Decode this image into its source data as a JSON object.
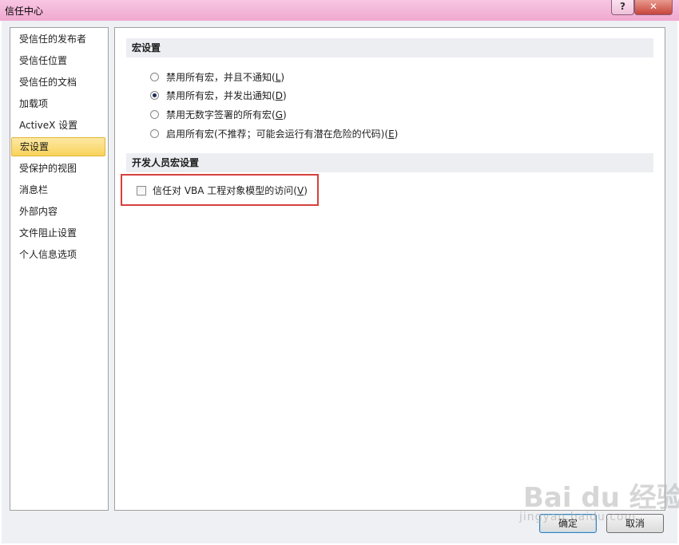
{
  "window": {
    "title": "信任中心"
  },
  "title_buttons": {
    "help": "?",
    "close": "✕"
  },
  "nav": {
    "items": [
      {
        "label": "受信任的发布者"
      },
      {
        "label": "受信任位置"
      },
      {
        "label": "受信任的文档"
      },
      {
        "label": "加载项"
      },
      {
        "label": "ActiveX 设置"
      },
      {
        "label": "宏设置"
      },
      {
        "label": "受保护的视图"
      },
      {
        "label": "消息栏"
      },
      {
        "label": "外部内容"
      },
      {
        "label": "文件阻止设置"
      },
      {
        "label": "个人信息选项"
      }
    ],
    "selected": "宏设置"
  },
  "macro_settings": {
    "header": "宏设置",
    "options": [
      {
        "text": "禁用所有宏，并且不通知(",
        "key": "L",
        "end": ")"
      },
      {
        "text": "禁用所有宏，并发出通知(",
        "key": "D",
        "end": ")"
      },
      {
        "text": "禁用无数字签署的所有宏(",
        "key": "G",
        "end": ")"
      },
      {
        "text": "启用所有宏(不推荐；可能会运行有潜在危险的代码)(",
        "key": "E",
        "end": ")"
      }
    ],
    "selected_index": 1
  },
  "developer": {
    "header": "开发人员宏设置",
    "checkbox_text": "信任对 VBA 工程对象模型的访问(",
    "checkbox_key": "V",
    "checkbox_end": ")",
    "checked": false
  },
  "buttons": {
    "ok": "确定",
    "cancel": "取消"
  },
  "watermark": {
    "logo": "Bai du 经验",
    "url": "jingyan.baidu.com"
  }
}
